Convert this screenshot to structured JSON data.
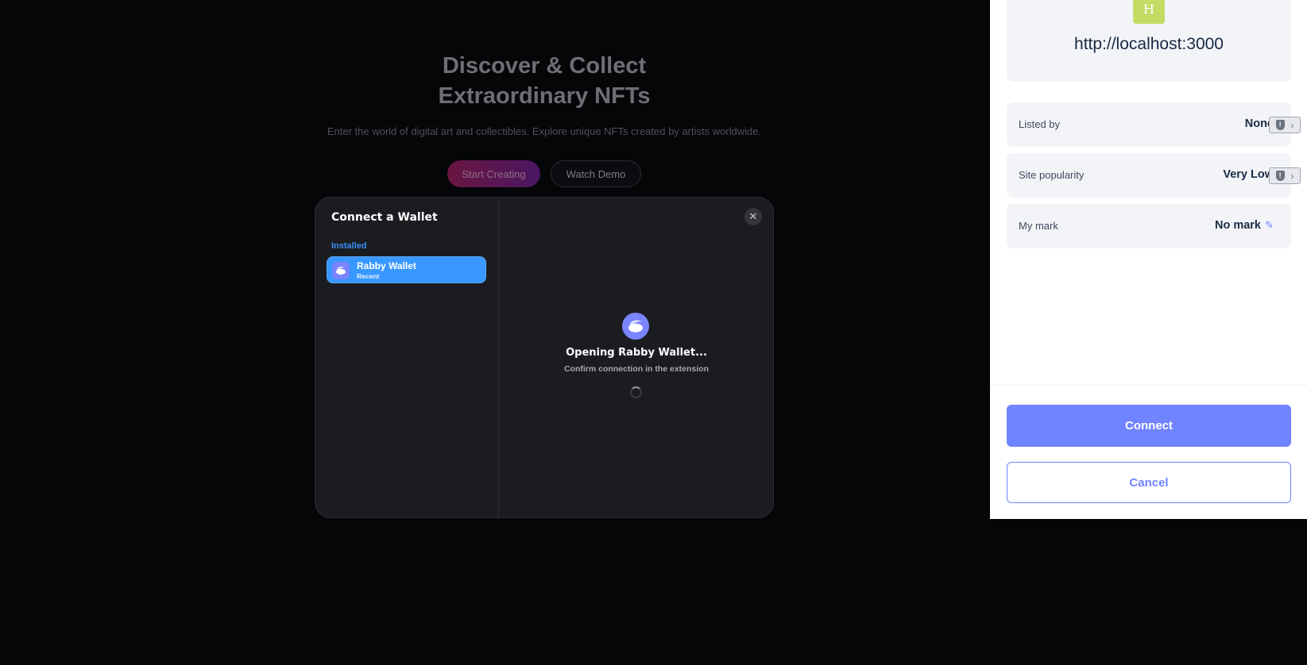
{
  "hero": {
    "title_line1": "Discover & Collect",
    "title_line2": "Extraordinary NFTs",
    "subtitle": "Enter the world of digital art and collectibles. Explore unique NFTs created by artists worldwide.",
    "start_label": "Start Creating",
    "demo_label": "Watch Demo"
  },
  "wallet_modal": {
    "title": "Connect a Wallet",
    "section_label": "Installed",
    "wallets": [
      {
        "name": "Rabby Wallet",
        "tag": "Recent",
        "icon": "rabbit-icon"
      }
    ],
    "connecting_title": "Opening Rabby Wallet...",
    "connecting_subtitle": "Confirm connection in the extension",
    "close_icon": "close-icon"
  },
  "extension": {
    "site_initial": "H",
    "site_url": "http://localhost:3000",
    "rows": [
      {
        "label": "Listed by",
        "value": "None"
      },
      {
        "label": "Site popularity",
        "value": "Very Low"
      },
      {
        "label": "My mark",
        "value": "No mark"
      }
    ],
    "connect_label": "Connect",
    "cancel_label": "Cancel"
  },
  "colors": {
    "accent": "#7084ff",
    "wallet_selected": "#3898ff",
    "modal_bg": "#1b1c20",
    "page_bg": "#050608"
  }
}
